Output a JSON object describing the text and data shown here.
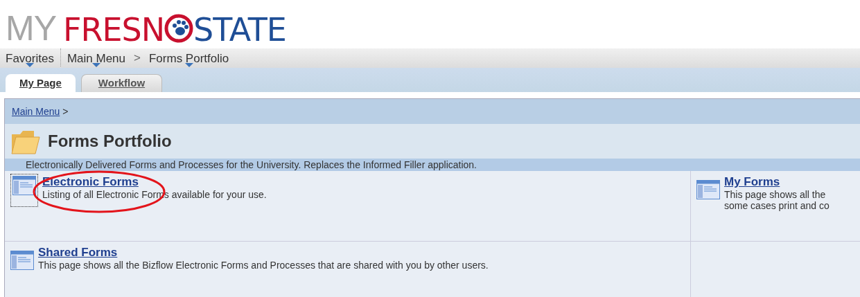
{
  "logo": {
    "my": "MY",
    "fresno": "FRESN",
    "state": "STATE"
  },
  "nav": [
    {
      "label": "Favorites",
      "dropdown": true
    },
    {
      "label": "Main Menu",
      "dropdown": true
    },
    {
      "label": "Forms Portfolio",
      "dropdown": true
    }
  ],
  "nav_separator": ">",
  "tabs": [
    {
      "label": "My Page",
      "selected": true
    },
    {
      "label": "Workflow",
      "selected": false
    }
  ],
  "breadcrumb": {
    "link": "Main Menu",
    "separator": ">"
  },
  "page": {
    "title": "Forms Portfolio",
    "description": "Electronically Delivered Forms and Processes for the University. Replaces the Informed Filler application."
  },
  "items": [
    {
      "title": "Electronic Forms",
      "description_lines": [
        "Listing of all Electronic Forms available for your use."
      ],
      "focused": true,
      "highlighted": true
    },
    {
      "title": "My Forms",
      "description_lines": [
        "This page shows all the",
        "some cases print and co"
      ],
      "focused": false,
      "highlighted": false
    },
    {
      "title": "Shared Forms",
      "description_lines": [
        "This page shows all the Bizflow Electronic Forms and Processes that are shared with you by other users."
      ],
      "focused": false,
      "highlighted": false
    }
  ]
}
